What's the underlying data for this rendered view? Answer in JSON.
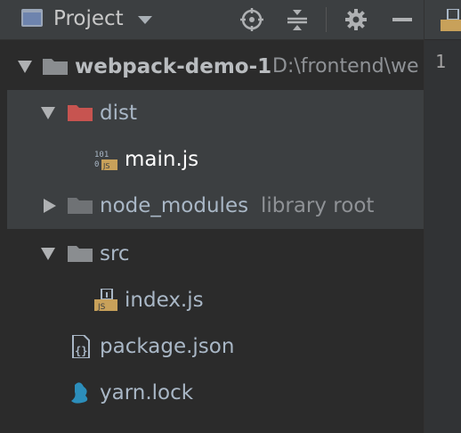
{
  "header": {
    "title": "Project",
    "icons": [
      "project-view-icon",
      "dropdown-caret-icon",
      "locate-icon",
      "collapse-all-icon",
      "gear-icon",
      "minimize-icon"
    ]
  },
  "tree": {
    "root": {
      "label": "webpack-demo-1",
      "path": "D:\\frontend\\we"
    },
    "items": [
      {
        "label": "dist"
      },
      {
        "label": "main.js"
      },
      {
        "label": "node_modules",
        "suffix": "library root"
      },
      {
        "label": "src"
      },
      {
        "label": "index.js"
      },
      {
        "label": "package.json"
      },
      {
        "label": "yarn.lock"
      }
    ]
  },
  "editor": {
    "line_numbers": [
      "1"
    ]
  },
  "colors": {
    "background": "#2b2b2b",
    "header": "#3c3f41",
    "selection": "#3c3f41",
    "excluded_folder": "#c75450",
    "folder": "#8a8d90",
    "js_badge": "#c8a15a",
    "yarn": "#2c8ebb"
  }
}
